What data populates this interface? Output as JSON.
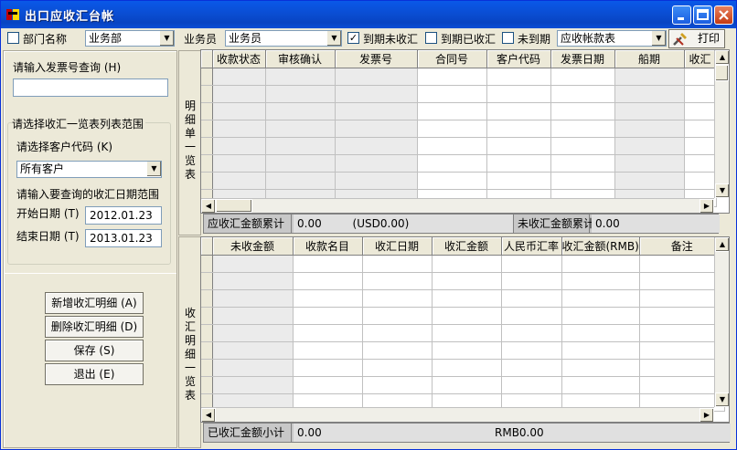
{
  "window": {
    "title": "出口应收汇台帐"
  },
  "toolbar": {
    "dept_check_label": "部门名称",
    "dept_value": "业务部",
    "salesman_label": "业务员",
    "salesman_value": "业务员",
    "due_unreceived_label": "到期未收汇",
    "due_unreceived_checked": true,
    "due_received_label": "到期已收汇",
    "not_due_label": "未到期",
    "report_value": "应收帐款表",
    "print_label": "打印"
  },
  "left": {
    "invoice_query_label": "请输入发票号查询 (H)",
    "invoice_query_value": "",
    "range_group_label": "请选择收汇一览表列表范围",
    "customer_code_label": "请选择客户代码 (K)",
    "customer_code_value": "所有客户",
    "date_range_label": "请输入要查询的收汇日期范围",
    "start_date_label": "开始日期 (T)",
    "start_date_value": "2012.01.23",
    "end_date_label": "结束日期 (T)",
    "end_date_value": "2013.01.23",
    "buttons": {
      "add": "新增收汇明细 (A)",
      "delete": "删除收汇明细 (D)",
      "save": "保存 (S)",
      "exit": "退出 (E)"
    }
  },
  "detail": {
    "side_label": "明细单一览表",
    "columns": [
      "收款状态",
      "审核确认",
      "发票号",
      "合同号",
      "客户代码",
      "发票日期",
      "船期",
      "收汇"
    ],
    "summary": {
      "total_label": "应收汇金额累计",
      "total_value": "0.00",
      "total_currency": "(USD0.00)",
      "unreceived_label": "未收汇金额累计",
      "unreceived_value": "0.00"
    }
  },
  "receipt": {
    "side_label": "收汇明细一览表",
    "columns": [
      "未收金额",
      "收款名目",
      "收汇日期",
      "收汇金额",
      "人民币汇率",
      "收汇金额(RMB)",
      "备注"
    ],
    "summary": {
      "subtotal_label": "已收汇金额小计",
      "subtotal_value": "0.00",
      "rmb_value": "RMB0.00"
    }
  },
  "colors": {
    "titlebar": "#0a4fd6",
    "face": "#ece9d8",
    "grid_gray": "#ebebeb",
    "summary": "#c8c8c8"
  }
}
